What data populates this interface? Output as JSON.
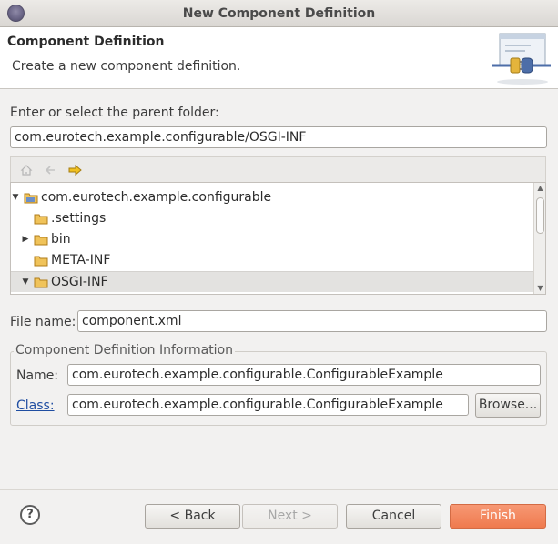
{
  "window": {
    "title": "New Component Definition"
  },
  "header": {
    "title": "Component Definition",
    "description": "Create a new component definition."
  },
  "parent_folder": {
    "label": "Enter or select the parent folder:",
    "value": "com.eurotech.example.configurable/OSGI-INF"
  },
  "toolbar": {
    "home_icon": "home-icon",
    "back_icon": "back-arrow-icon",
    "forward_icon": "forward-arrow-icon"
  },
  "tree": {
    "items": [
      {
        "label": "com.eurotech.example.configurable",
        "expanded": true
      },
      {
        "label": ".settings"
      },
      {
        "label": "bin",
        "expanded": false
      },
      {
        "label": "META-INF"
      },
      {
        "label": "OSGI-INF",
        "expanded": true,
        "selected": true
      }
    ]
  },
  "file_name": {
    "label": "File name:",
    "value": "component.xml"
  },
  "component_info": {
    "title": "Component Definition Information",
    "name_label": "Name:",
    "name_value": "com.eurotech.example.configurable.ConfigurableExample",
    "class_label": "Class:",
    "class_value": "com.eurotech.example.configurable.ConfigurableExample",
    "browse_label": "Browse..."
  },
  "buttons": {
    "help": "?",
    "back": "< Back",
    "next": "Next >",
    "cancel": "Cancel",
    "finish": "Finish"
  },
  "colors": {
    "accent": "#f08a60",
    "link": "#1f4da1",
    "folder": "#e8a83a"
  }
}
